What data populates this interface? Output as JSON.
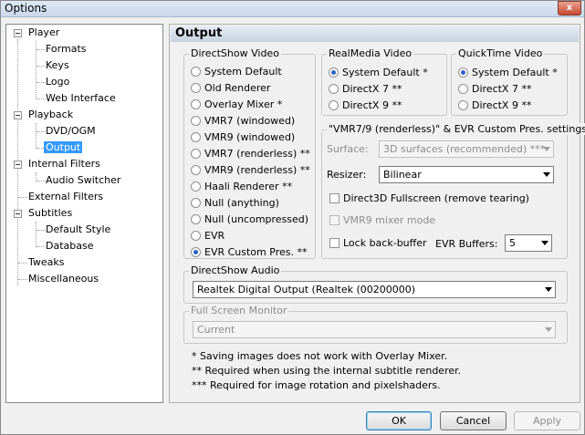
{
  "window": {
    "title": "Options",
    "close_glyph": "x"
  },
  "tree": {
    "player": "Player",
    "formats": "Formats",
    "keys": "Keys",
    "logo": "Logo",
    "web_interface": "Web Interface",
    "playback": "Playback",
    "dvd_ogm": "DVD/OGM",
    "output": "Output",
    "internal_filters": "Internal Filters",
    "audio_switcher": "Audio Switcher",
    "external_filters": "External Filters",
    "subtitles": "Subtitles",
    "default_style": "Default Style",
    "database": "Database",
    "tweaks": "Tweaks",
    "miscellaneous": "Miscellaneous"
  },
  "header": {
    "title": "Output"
  },
  "directshow_video": {
    "label": "DirectShow Video",
    "options": [
      "System Default",
      "Old Renderer",
      "Overlay Mixer *",
      "VMR7 (windowed)",
      "VMR9 (windowed)",
      "VMR7 (renderless) **",
      "VMR9 (renderless) **",
      "Haali Renderer **",
      "Null (anything)",
      "Null (uncompressed)",
      "EVR",
      "EVR Custom Pres. **"
    ],
    "selected_index": 11
  },
  "realmedia_video": {
    "label": "RealMedia Video",
    "options": [
      "System Default *",
      "DirectX 7 **",
      "DirectX 9 **"
    ],
    "selected_index": 0
  },
  "quicktime_video": {
    "label": "QuickTime Video",
    "options": [
      "System Default *",
      "DirectX 7 **",
      "DirectX 9 **"
    ],
    "selected_index": 0
  },
  "vmr_settings": {
    "label": "\"VMR7/9 (renderless)\" & EVR Custom Pres. settings",
    "surface_label": "Surface:",
    "surface_value": "3D surfaces (recommended) ***",
    "resizer_label": "Resizer:",
    "resizer_value": "Bilinear",
    "d3d_fullscreen": "Direct3D Fullscreen (remove tearing)",
    "vmr9_mixer": "VMR9 mixer mode",
    "lock_back_buffer": "Lock back-buffer",
    "evr_buffers_label": "EVR Buffers:",
    "evr_buffers_value": "5"
  },
  "directshow_audio": {
    "label": "DirectShow Audio",
    "value": "Realtek Digital Output (Realtek (00200000)"
  },
  "fullscreen_monitor": {
    "label": "Full Screen Monitor",
    "value": "Current"
  },
  "notes": [
    "* Saving images does not work with Overlay Mixer.",
    "** Required when using the internal subtitle renderer.",
    "*** Required for image rotation and pixelshaders."
  ],
  "buttons": {
    "ok": "OK",
    "cancel": "Cancel",
    "apply": "Apply"
  },
  "colors": {
    "selection": "#3399ff",
    "header_bg": "#c5d2e0",
    "window_bg": "#f0f0f0"
  }
}
